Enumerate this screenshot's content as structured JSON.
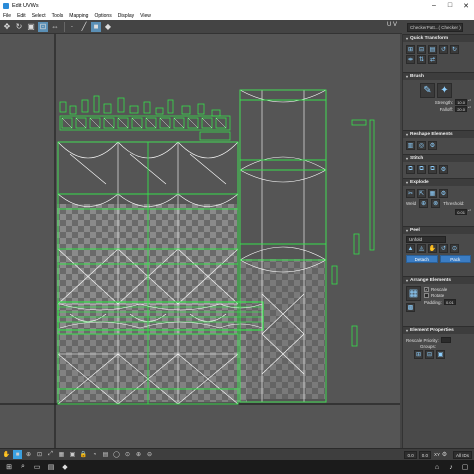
{
  "window": {
    "title": "Edit UVWs"
  },
  "menu": [
    "File",
    "Edit",
    "Select",
    "Tools",
    "Mapping",
    "Options",
    "Display",
    "View"
  ],
  "toolbar": {
    "icons": [
      "move-icon",
      "rotate-icon",
      "scale-icon",
      "freeform-icon",
      "mirror-icon",
      "vertex-icon",
      "edge-icon",
      "polygon-icon",
      "element-icon"
    ],
    "uv_label": "U V",
    "texture_select": "CheckerPatt...( Checker )"
  },
  "panel": {
    "quick_transform": {
      "title": "Quick Transform"
    },
    "brush": {
      "title": "Brush",
      "strength_label": "Strength:",
      "strength_value": "10.0",
      "falloff_label": "Falloff:",
      "falloff_value": "20.0"
    },
    "reshape": {
      "title": "Reshape Elements"
    },
    "stitch": {
      "title": "Stitch"
    },
    "explode": {
      "title": "Explode",
      "weld_label": "Weld",
      "threshold_label": "Threshold:",
      "threshold_value": "0.01"
    },
    "peel": {
      "title": "Peel",
      "method": "Unfold",
      "detach_label": "Detach",
      "pack_label": "Pack"
    },
    "arrange": {
      "title": "Arrange Elements",
      "rescale_label": "Rescale",
      "rotate_label": "Rotate",
      "padding_label": "Padding:",
      "padding_value": "0.01"
    },
    "element_props": {
      "title": "Element Properties",
      "rescale_priority_label": "Rescale Priority:",
      "groups_label": "Groups:"
    }
  },
  "status": {
    "u_value": "0.0",
    "v_value": "0.0",
    "xy_label": "XY",
    "all_ids": "All IDs"
  },
  "colors": {
    "accent_blue": "#3b7dc4",
    "uv_green": "#35e04a",
    "uv_white": "#ffffff",
    "bg": "#444444"
  }
}
